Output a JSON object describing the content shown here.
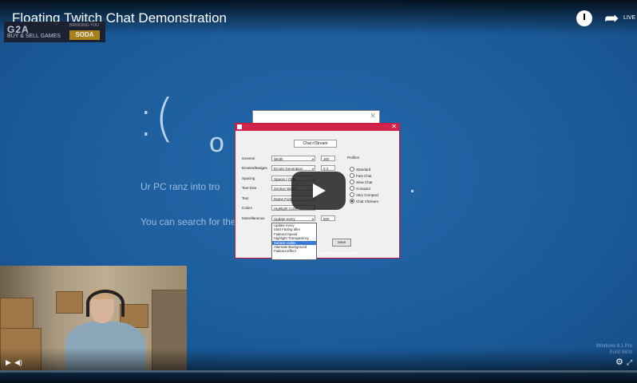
{
  "video": {
    "title": "Floating Twitch Chat Demonstration",
    "share_label": "LIVE"
  },
  "logo": {
    "main": "G2A",
    "sub": "BUY & SELL GAMES",
    "brand_top": "BRINGING YOU",
    "brand": "SODA"
  },
  "bsod": {
    "face": ":(",
    "face_tail": "o",
    "line1": "Ur PC ranz into tro",
    "line2": "You can search for the",
    "build": "Windows 8.1 Pro\nBuild 9600"
  },
  "dialog": {
    "name_value": "Chat r/Stream",
    "rows": [
      {
        "label": "General",
        "combo": "Width",
        "spin": "300"
      },
      {
        "label": "Emotes/Badges",
        "combo": "Emote Generation",
        "spin": "0.3"
      },
      {
        "label": "Spacing",
        "combo": "Spacer / Chat",
        "spin": ""
      },
      {
        "label": "Text Size",
        "combo": "Section Width",
        "spin": ""
      },
      {
        "label": "Text",
        "combo": "Name Font",
        "spin": ""
      },
      {
        "label": "Colors",
        "combo": "Highlight Color",
        "spin": ""
      },
      {
        "label": "Miscellaneous",
        "combo": "Update every",
        "spin": "800"
      }
    ],
    "profiles_header": "Profiles",
    "profiles": [
      "Standard",
      "Fast Chat",
      "Slow Chat",
      "Compact",
      "Very Compact",
      "Chat r/Stream"
    ],
    "selected_profile": "Chat r/Stream",
    "dropdown_options": [
      "Update every",
      "Start Fading after",
      "Fadeout Speed",
      "Highlight Transparency",
      "Subtext visible",
      "Alternate Background",
      "Fadeout Effect"
    ],
    "highlighted_option": "Subtext visible",
    "save_label": "Save",
    "hint": "hat window to show effect"
  },
  "controls": {
    "play_icon": "play-icon",
    "volume_icon": "volume-icon",
    "settings_icon": "gear-icon",
    "fullscreen_icon": "fullscreen-icon"
  }
}
